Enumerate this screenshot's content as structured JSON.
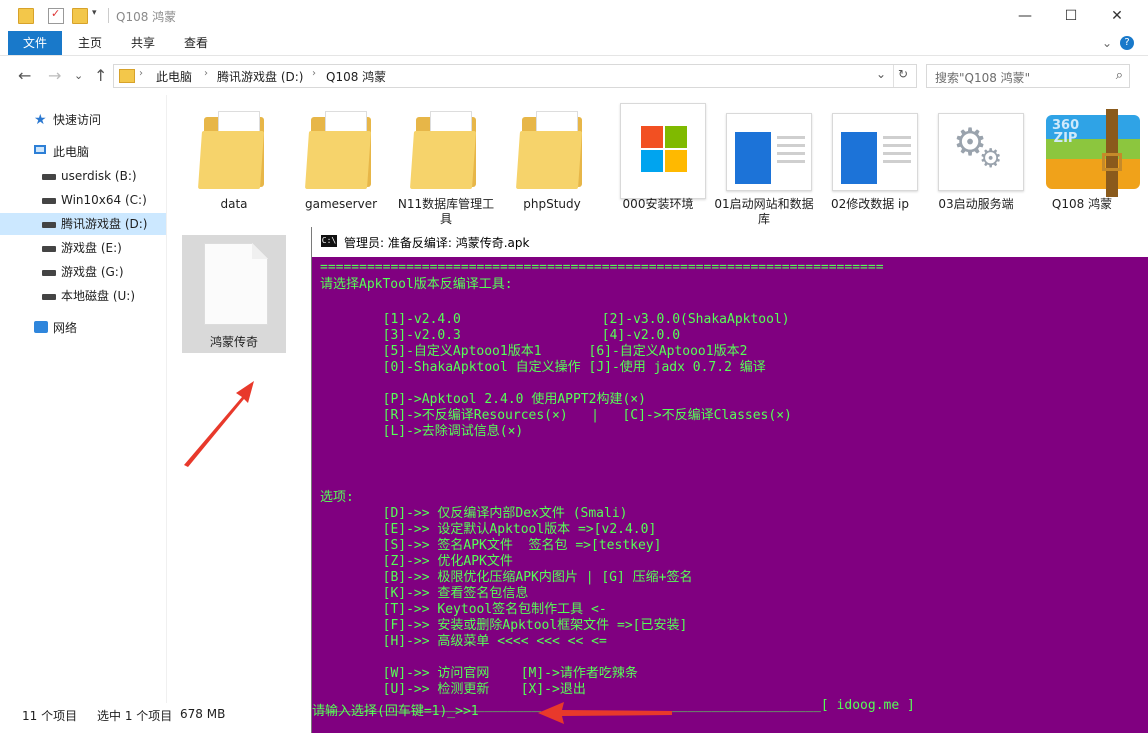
{
  "window": {
    "title": "Q108 鸿蒙",
    "minimize": "—",
    "maximize": "☐",
    "close": "✕"
  },
  "ribbon": {
    "tabs": [
      "文件",
      "主页",
      "共享",
      "查看"
    ],
    "expand": "⌄",
    "help": "?"
  },
  "nav_buttons": {
    "back": "←",
    "forward": "→",
    "history": "⌄",
    "up": "↑",
    "refresh": "↻",
    "dropdown": "⌄"
  },
  "address": {
    "crumbs": [
      "此电脑",
      "腾讯游戏盘 (D:)",
      "Q108 鸿蒙"
    ]
  },
  "search": {
    "placeholder": "搜索\"Q108 鸿蒙\"",
    "icon": "⌕"
  },
  "sidebar": {
    "items": [
      {
        "label": "快速访问",
        "icon": "star-icon"
      },
      {
        "label": "此电脑",
        "icon": "pc-icon"
      },
      {
        "label": "userdisk (B:)",
        "icon": "drive-icon"
      },
      {
        "label": "Win10x64 (C:)",
        "icon": "drive-icon"
      },
      {
        "label": "腾讯游戏盘 (D:)",
        "icon": "drive-icon"
      },
      {
        "label": "游戏盘 (E:)",
        "icon": "drive-icon"
      },
      {
        "label": "游戏盘 (G:)",
        "icon": "drive-icon"
      },
      {
        "label": "本地磁盘 (U:)",
        "icon": "drive-icon"
      },
      {
        "label": "网络",
        "icon": "network-icon"
      }
    ]
  },
  "files": [
    {
      "name": "data"
    },
    {
      "name": "gameserver"
    },
    {
      "name": "N11数据库管理工具"
    },
    {
      "name": "phpStudy"
    },
    {
      "name": "000安装环境"
    },
    {
      "name": "01启动网站和数据库"
    },
    {
      "name": "02修改数据 ip"
    },
    {
      "name": "03启动服务端"
    },
    {
      "name": "Q108 鸿蒙"
    },
    {
      "name": "鸿蒙传奇"
    }
  ],
  "status": {
    "count": "11 个项目",
    "selected": "选中 1 个项目",
    "size": "678 MB"
  },
  "console": {
    "icon_text": "C:\\",
    "title": "管理员: 准备反编译: 鸿蒙传奇.apk",
    "lines": [
      "========================================================================",
      "请选择ApkTool版本反编译工具:",
      "",
      "        [1]-v2.4.0                  [2]-v3.0.0(ShakaApktool)",
      "        [3]-v2.0.3                  [4]-v2.0.0",
      "        [5]-自定义Aptooo1版本1      [6]-自定义Aptooo1版本2",
      "        [0]-ShakaApktool 自定义操作 [J]-使用 jadx 0.7.2 编译",
      "",
      "        [P]->Apktool 2.4.0 使用APPT2构建(×)",
      "        [R]->不反编译Resources(×)   |   [C]->不反编译Classes(×)",
      "        [L]->去除调试信息(×)",
      "",
      "",
      "",
      "选项:",
      "        [D]->> 仅反编译内部Dex文件 (Smali)",
      "        [E]->> 设定默认Apktool版本 =>[v2.4.0]",
      "        [S]->> 签名APK文件  签名包 =>[testkey]",
      "        [Z]->> 优化APK文件",
      "        [B]->> 极限优化压缩APK内图片 | [G] 压缩+签名",
      "        [K]->> 查看签名包信息",
      "        [T]->> Keytool签名包制作工具 <-",
      "        [F]->> 安装或删除Apktool框架文件 =>[已安装]",
      "        [H]->> 高级菜单 <<<< <<< << <=",
      "",
      "        [W]->> 访问官网    [M]->请作者吃辣条",
      "        [U]->> 检测更新    [X]->退出",
      "________________________________________________________________[ idoog.me ]",
      "",
      "请输入选择(回车键=1)_>>1"
    ]
  },
  "colors": {
    "console_bg": "#800080",
    "console_fg": "#55ff55",
    "accent": "#1979ca",
    "arrow": "#e8392b"
  }
}
